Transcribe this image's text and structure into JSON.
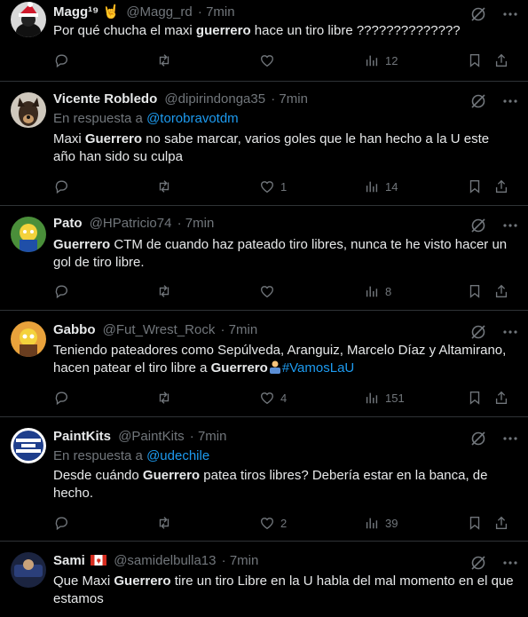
{
  "tweets": [
    {
      "name": "Magg¹⁹",
      "emoji": "🤘",
      "handle": "@Magg_rd",
      "time": "· 7min",
      "reply_label": "",
      "reply_to": "",
      "text_pre": "Por qué chucha el maxi ",
      "text_bold": "guerrero",
      "text_post": " hace un tiro libre ??????????????",
      "replies": "",
      "reposts": "",
      "likes": "",
      "views": "12"
    },
    {
      "name": "Vicente Robledo",
      "handle": "@dipirindonga35",
      "time": "· 7min",
      "reply_label": "En respuesta a ",
      "reply_to": "@torobravotdm",
      "text_pre": "Maxi ",
      "text_bold": "Guerrero",
      "text_post": " no sabe marcar, varios goles que le han hecho a la U este año han sido su culpa",
      "replies": "",
      "reposts": "",
      "likes": "1",
      "views": "14"
    },
    {
      "name": "Pato",
      "handle": "@HPatricio74",
      "time": "· 7min",
      "reply_label": "",
      "reply_to": "",
      "text_pre": "",
      "text_bold": "Guerrero",
      "text_post": " CTM de cuando haz pateado tiro libres, nunca te he visto hacer un gol de tiro libre.",
      "replies": "",
      "reposts": "",
      "likes": "",
      "views": "8"
    },
    {
      "name": "Gabbo",
      "handle": "@Fut_Wrest_Rock",
      "time": "· 7min",
      "reply_label": "",
      "reply_to": "",
      "text_pre": "Teniendo pateadores como Sepúlveda, Aranguiz, Marcelo Díaz y Altamirano, hacen patear el tiro libre a ",
      "text_bold": "Guerrero",
      "text_post": "",
      "hashtag": "#VamosLaU",
      "replies": "",
      "reposts": "",
      "likes": "4",
      "views": "151"
    },
    {
      "name": "PaintKits",
      "handle": "@PaintKits",
      "time": "· 7min",
      "reply_label": "En respuesta a ",
      "reply_to": "@udechile",
      "text_pre": "Desde cuándo ",
      "text_bold": "Guerrero",
      "text_post": " patea tiros libres? Debería estar en la banca, de hecho.",
      "replies": "",
      "reposts": "",
      "likes": "2",
      "views": "39"
    },
    {
      "name": "Sami",
      "emoji": "🇨🇦",
      "handle": "@samidelbulla13",
      "time": "· 7min",
      "reply_label": "",
      "reply_to": "",
      "text_pre": "Que Maxi ",
      "text_bold": "Guerrero",
      "text_post": " tire un tiro Libre en la U habla del mal momento en el que estamos",
      "replies": "",
      "reposts": "",
      "likes": "",
      "views": ""
    }
  ],
  "colors": {
    "background": "#000000",
    "text": "#e7e9ea",
    "muted": "#71767b",
    "link": "#1d9bf0",
    "divider": "#2f3336"
  }
}
